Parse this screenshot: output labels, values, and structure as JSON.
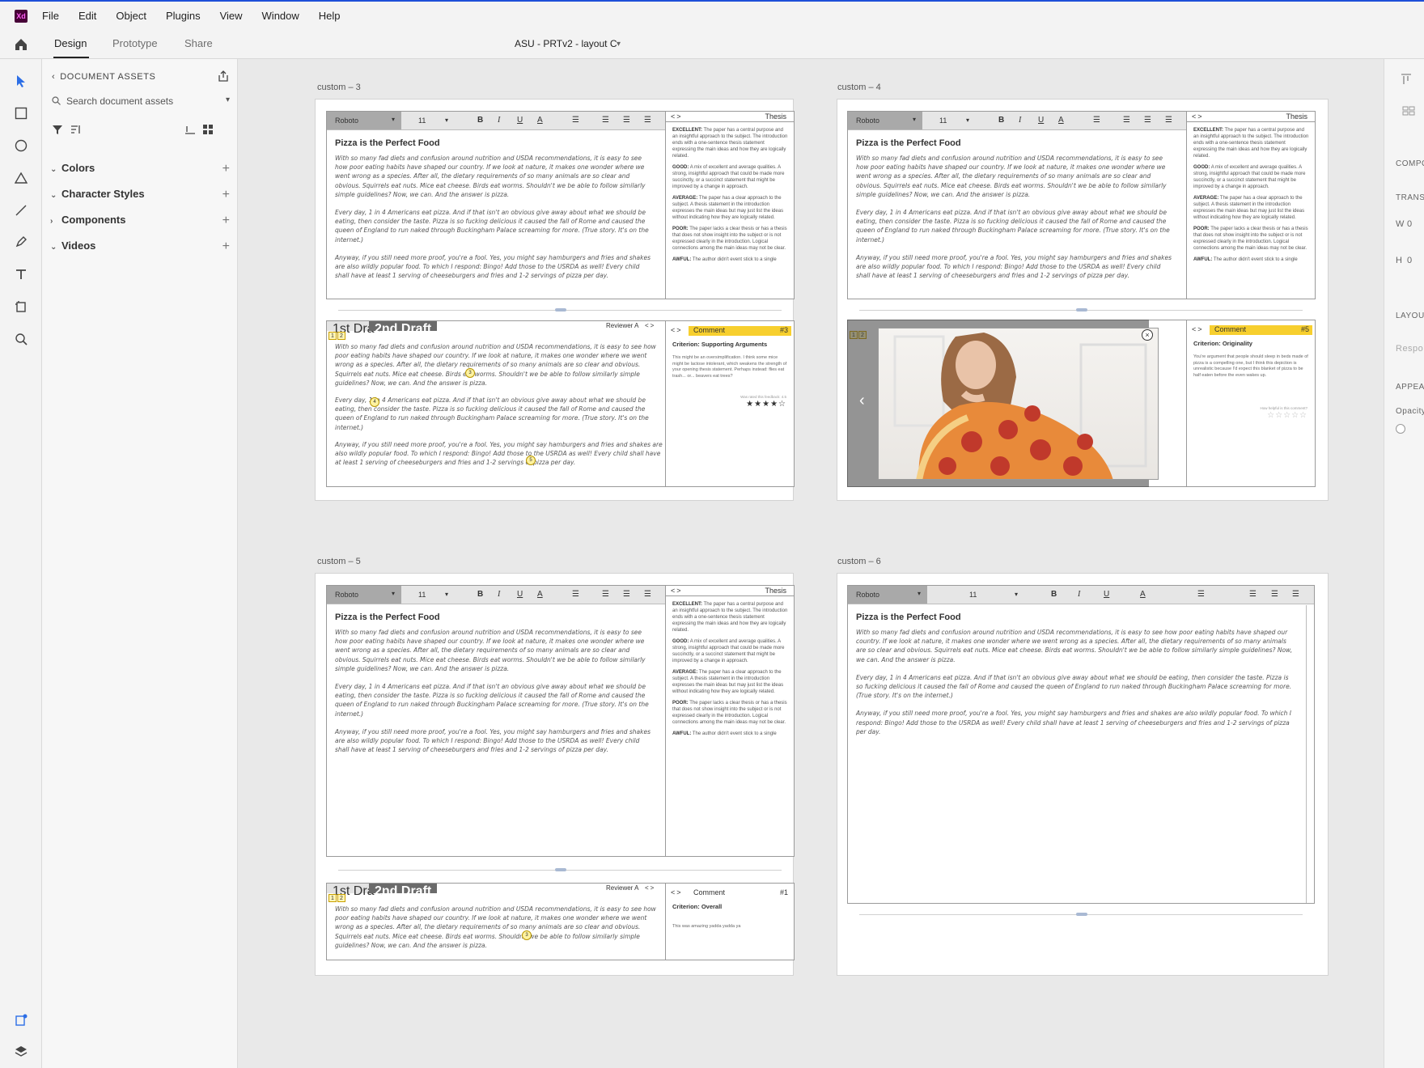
{
  "app": {
    "logo": "Xd",
    "menu": [
      "File",
      "Edit",
      "Object",
      "Plugins",
      "View",
      "Window",
      "Help"
    ],
    "modes": [
      "Design",
      "Prototype",
      "Share"
    ],
    "document_title": "ASU - PRTv2 - layout C"
  },
  "assets": {
    "header": "DOCUMENT ASSETS",
    "search_placeholder": "Search document assets",
    "sections": [
      "Colors",
      "Character Styles",
      "Components",
      "Videos"
    ]
  },
  "inspector": {
    "labels": [
      "COMPO",
      "TRANS",
      "W",
      "0",
      "H",
      "0",
      "LAYOU",
      "Respo",
      "APPEA",
      "Opacity"
    ]
  },
  "essay": {
    "title": "Pizza is the Perfect Food",
    "p1": "With so many fad diets and confusion around nutrition and USDA recommendations, it is easy to see how poor eating habits have shaped our country. If we look at nature, it makes one wonder where we went wrong as a species. After all, the dietary requirements of so many animals are so clear and obvious. Squirrels eat nuts. Mice eat cheese. Birds eat worms. Shouldn't we be able to follow similarly simple guidelines? Now, we can. And the answer is pizza.",
    "p2": "Every day, 1 in 4 Americans eat pizza. And if that isn't an obvious give away about what we should be eating, then consider the taste. Pizza is so fucking delicious it caused the fall of Rome and caused the queen of England to run naked through Buckingham Palace screaming for more. (True story. It's on the internet.)",
    "p3": "Anyway, if you still need more proof, you're a fool. Yes, you might say hamburgers and fries and shakes are also wildly popular food. To which I respond: Bingo! Add those to the USRDA as well! Every child shall have at least 1 serving of cheeseburgers and fries and 1-2 servings of pizza per day."
  },
  "toolbar": {
    "font": "Roboto",
    "size": "11",
    "bold": "B",
    "italic": "I",
    "underline": "U",
    "color": "A",
    "arrow": "▾"
  },
  "rubric": {
    "nav": "<>",
    "title": "Thesis",
    "items": [
      {
        "label": "EXCELLENT:",
        "text": "The paper has a central purpose and an insightful approach to the subject. The introduction ends with a one-sentence thesis statement expressing the main ideas and how they are logically related."
      },
      {
        "label": "GOOD:",
        "text": "A mix of excellent and average qualities. A strong, insightful approach that could be made more succinctly, or a succinct statement that might be improved by a change in approach."
      },
      {
        "label": "AVERAGE:",
        "text": "The paper has a clear approach to the subject. A thesis statement in the introduction expresses the main ideas but may just list the ideas without indicating how they are logically related."
      },
      {
        "label": "POOR:",
        "text": "The paper lacks a clear thesis or has a thesis that does not show insight into the subject or is not expressed clearly in the introduction. Logical connections among the main ideas may not be clear."
      },
      {
        "label": "AWFUL:",
        "text": "The author didn't event stick to a single"
      }
    ]
  },
  "review": {
    "tab1": "1st Draft",
    "tab2": "2nd Draft",
    "reviewer": "Reviewer A",
    "nav": "<>",
    "badges": [
      "1",
      "2"
    ],
    "markers": [
      "3",
      "4",
      "5"
    ]
  },
  "artboards": {
    "a3": {
      "label": "custom – 3",
      "comment": {
        "title": "Comment",
        "number": "#3",
        "criterion": "Criterion: Supporting Arguments",
        "text": "This might be an oversimplification. I think some mice might be lactose intolerant, which weakens the strength of your opening thesis statement. Perhaps instead: flies eat trash... or... beavers eat trees?",
        "helpful": "Was rated this feedback: 4.5",
        "stars": "★★★★☆"
      }
    },
    "a4": {
      "label": "custom – 4",
      "comment": {
        "title": "Comment",
        "number": "#5",
        "criterion": "Criterion: Originality",
        "text": "You're argument that people should sleep in beds made of pizza is a compelling one, but I think this depiction is unrealistic because I'd expect this blanket of pizza to be half eaten before the even wakes up.",
        "helpful": "How helpful is this comment?",
        "stars": "☆☆☆☆☆"
      },
      "lightbox_close": "×",
      "prev": "‹",
      "next": "›"
    },
    "a5": {
      "label": "custom – 5",
      "comment": {
        "title": "Comment",
        "number": "#1",
        "criterion": "Criterion: Overall",
        "text": "This was amazing yadda yadda ya"
      }
    },
    "a6": {
      "label": "custom – 6"
    }
  }
}
